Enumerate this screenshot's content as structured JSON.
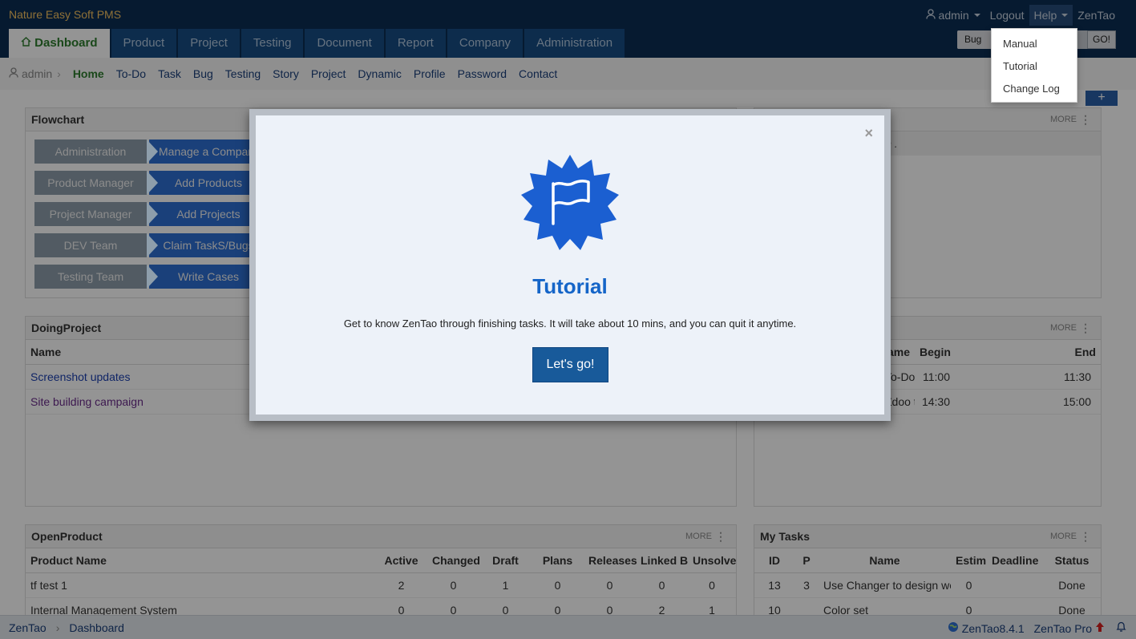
{
  "header": {
    "brand": "Nature Easy Soft PMS",
    "user": "admin",
    "logout": "Logout",
    "help": "Help",
    "zentao": "ZenTao",
    "search_type": "Bug",
    "search_go": "GO!"
  },
  "main_nav": [
    "Dashboard",
    "Product",
    "Project",
    "Testing",
    "Document",
    "Report",
    "Company",
    "Administration"
  ],
  "sub_nav": {
    "user": "admin",
    "items": [
      "Home",
      "To-Do",
      "Task",
      "Bug",
      "Testing",
      "Story",
      "Project",
      "Dynamic",
      "Profile",
      "Password",
      "Contact"
    ]
  },
  "help_menu": [
    "Manual",
    "Tutorial",
    "Change Log"
  ],
  "flowchart": {
    "title": "Flowchart",
    "rows": [
      {
        "role": "Administration",
        "action": "Manage a Company"
      },
      {
        "role": "Product Manager",
        "action": "Add Products"
      },
      {
        "role": "Project Manager",
        "action": "Add Projects"
      },
      {
        "role": "DEV Team",
        "action": "Claim TaskS/Bugs"
      },
      {
        "role": "Testing Team",
        "action": "Write Cases"
      }
    ]
  },
  "dynamic_panel": {
    "more": "MORE",
    "partial_text": "in ."
  },
  "doing_project": {
    "title": "DoingProject",
    "column": "Name",
    "rows": [
      "Screenshot updates",
      "Site building campaign"
    ]
  },
  "todo_panel": {
    "more": "MORE",
    "columns": [
      "Name",
      "Begin",
      "End"
    ],
    "rows": [
      {
        "name": "To-Do",
        "begin": "11:00",
        "end": "11:30"
      },
      {
        "name": "Zdoo to deploy company man",
        "begin": "14:30",
        "end": "15:00"
      }
    ]
  },
  "open_product": {
    "title": "OpenProduct",
    "more": "MORE",
    "columns": [
      "Product Name",
      "Active",
      "Changed",
      "Draft",
      "Plans",
      "Releases",
      "Linked Bu",
      "Unsolve"
    ],
    "rows": [
      [
        "tf test 1",
        "2",
        "0",
        "1",
        "0",
        "0",
        "0",
        "0"
      ],
      [
        "Internal Management System",
        "0",
        "0",
        "0",
        "0",
        "0",
        "2",
        "1"
      ]
    ]
  },
  "my_tasks": {
    "title": "My Tasks",
    "more": "MORE",
    "columns": [
      "ID",
      "P",
      "Name",
      "Estim",
      "Deadline",
      "Status"
    ],
    "rows": [
      [
        "13",
        "3",
        "Use Changer to design webs",
        "0",
        "",
        "Done"
      ],
      [
        "10",
        "",
        "Color set",
        "0",
        "",
        "Done"
      ]
    ]
  },
  "modal": {
    "close": "×",
    "title": "Tutorial",
    "text": "Get to know ZenTao through finishing tasks. It will take about 10 mins, and you can quit it anytime.",
    "button": "Let's go!"
  },
  "footer": {
    "crumbs": [
      "ZenTao",
      "Dashboard"
    ],
    "version": "ZenTao8.4.1",
    "pro": "ZenTao Pro"
  },
  "colors": {
    "header_bg": "#0b2d54",
    "brand": "#f5c15f",
    "accent_blue": "#1565c8",
    "flow_blue": "#2d6fd3",
    "flow_grey": "#8e9eab",
    "active_green": "#2e7d2e"
  },
  "icons": [
    "user-icon",
    "home-icon",
    "flag-badge-icon",
    "chevron-right-icon",
    "globe-icon",
    "upgrade-arrow-icon",
    "bell-icon",
    "plus-icon"
  ]
}
